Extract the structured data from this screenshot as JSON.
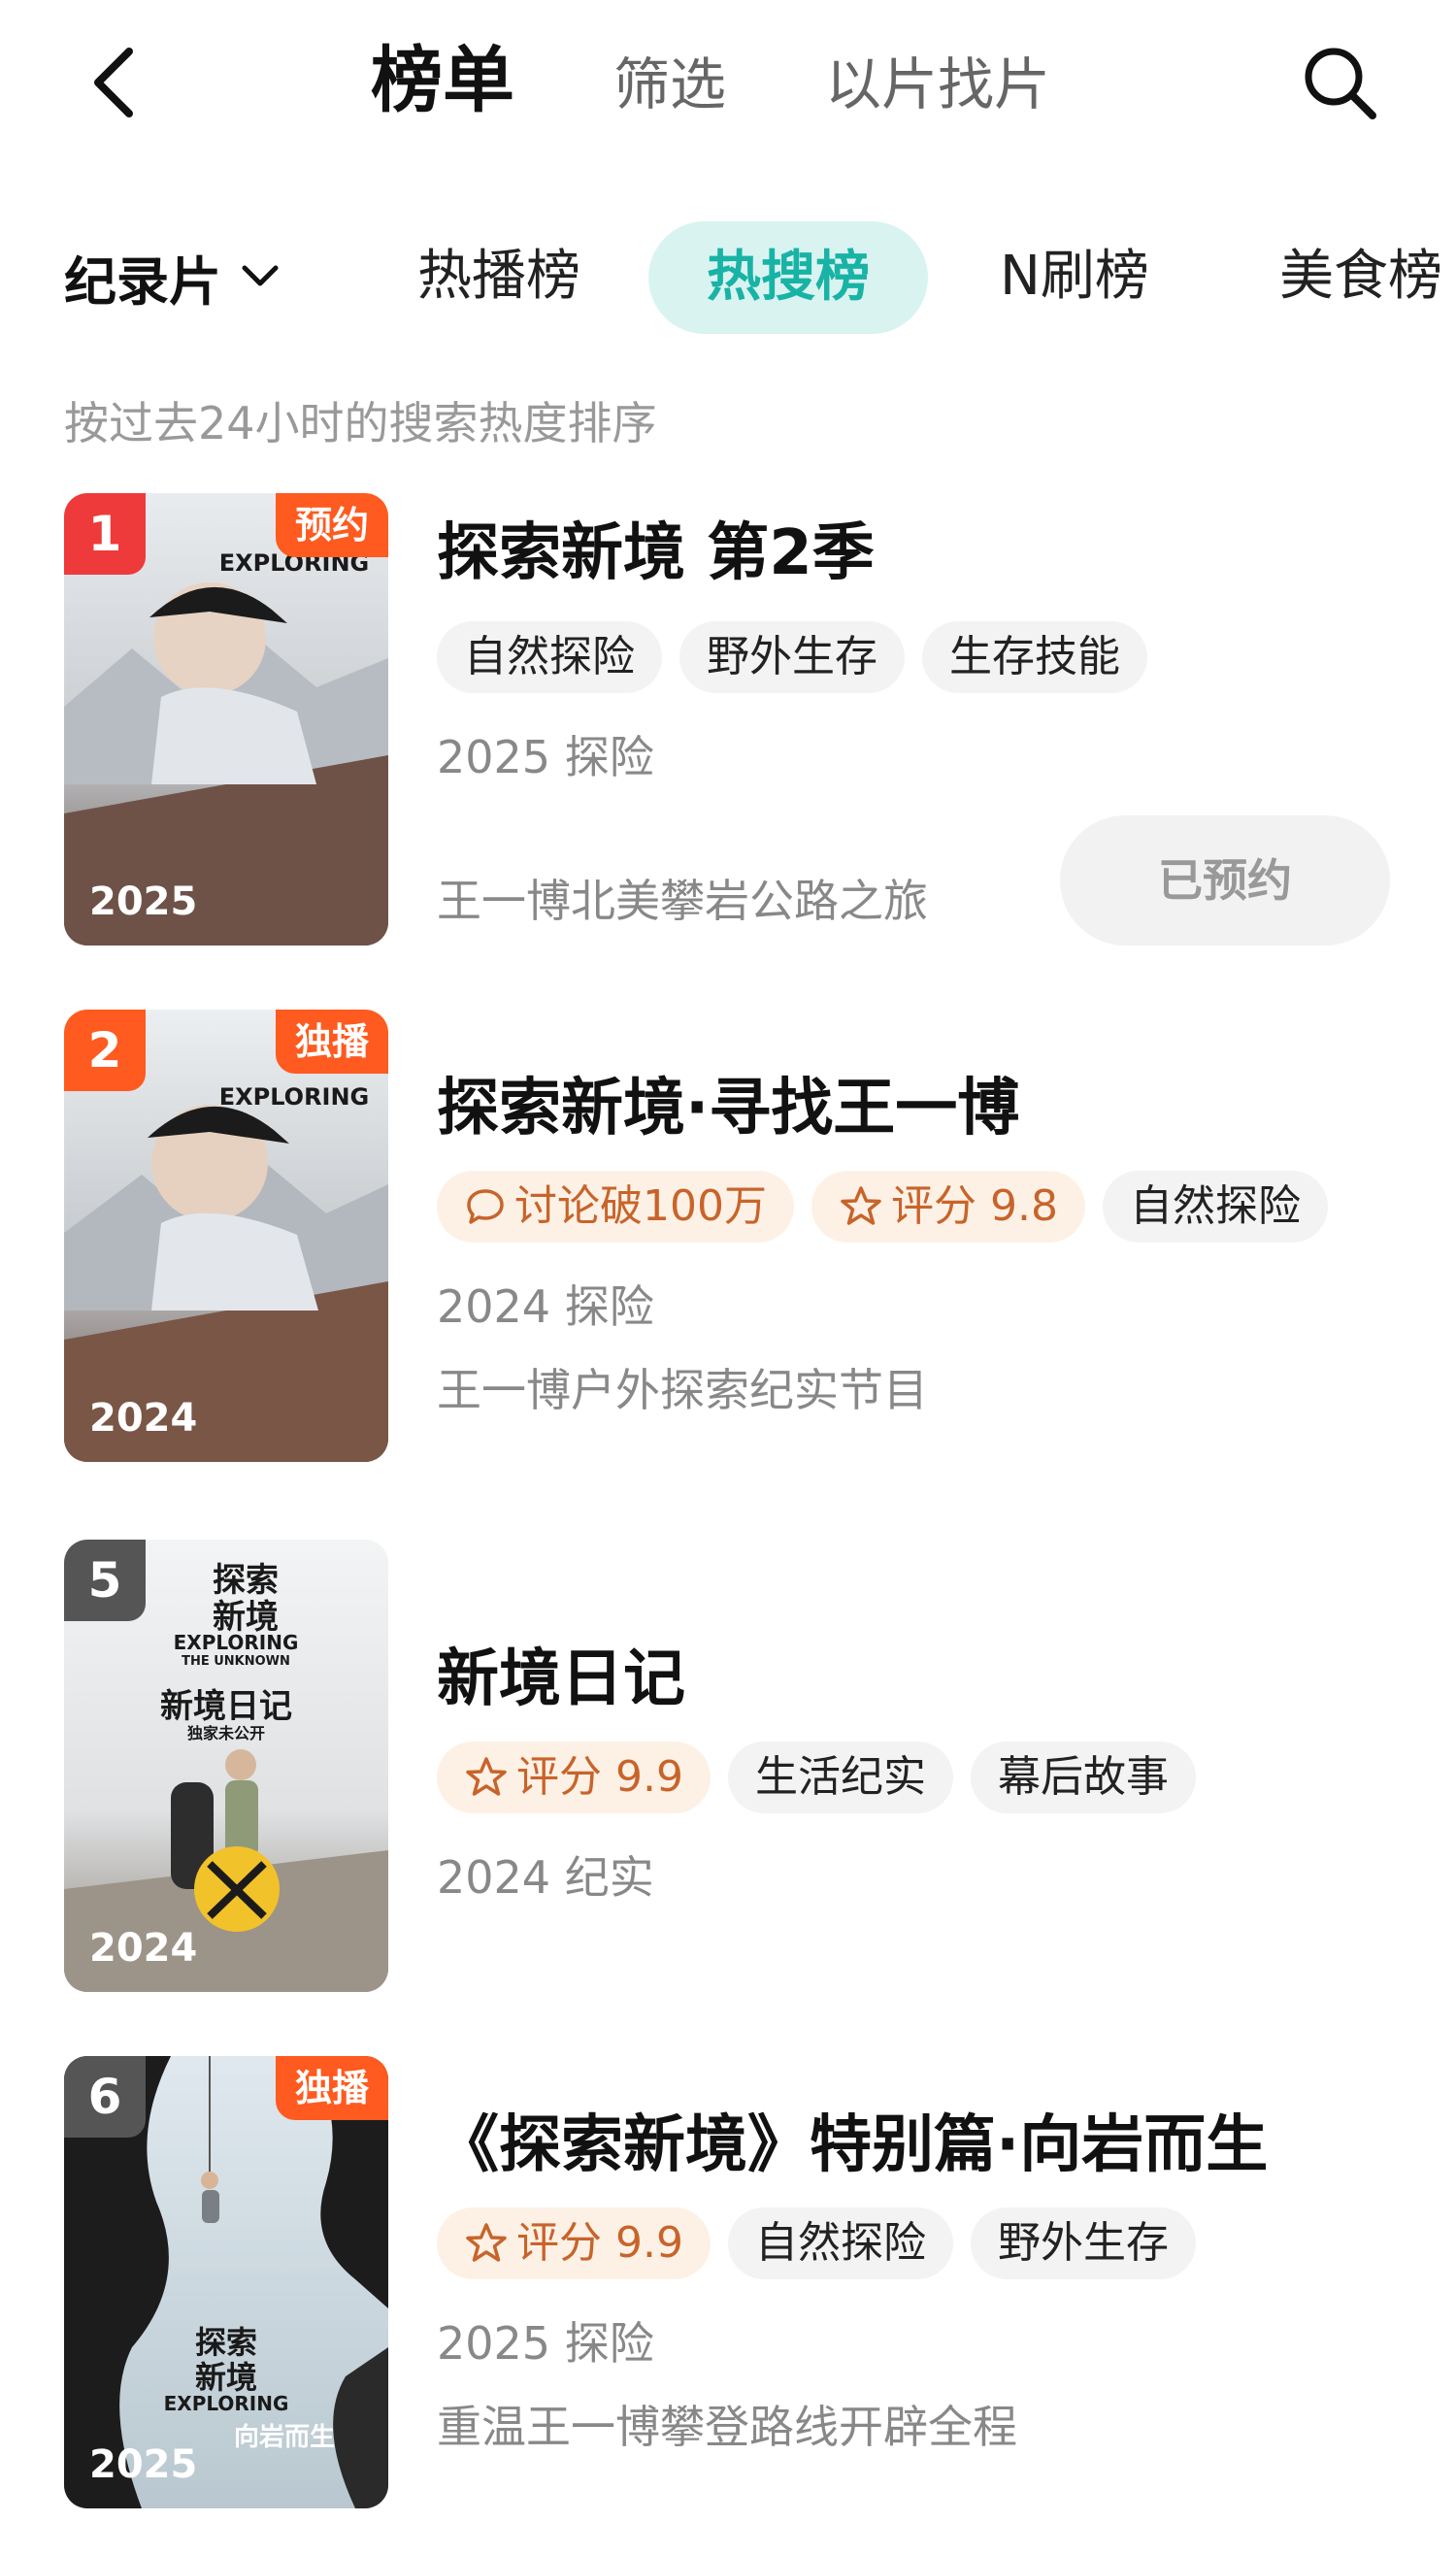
{
  "header": {
    "tabs": [
      {
        "label": "榜单",
        "active": true
      },
      {
        "label": "筛选",
        "active": false
      },
      {
        "label": "以片找片",
        "active": false
      }
    ],
    "back_icon": "chevron-left-icon",
    "search_icon": "search-icon"
  },
  "category": {
    "selected": "纪录片",
    "tabs": [
      {
        "label": "热播榜",
        "active": false
      },
      {
        "label": "热搜榜",
        "active": true
      },
      {
        "label": "N刷榜",
        "active": false
      },
      {
        "label": "美食榜",
        "active": false
      }
    ],
    "active_color": "#18b3a5"
  },
  "hint": "按过去24小时的搜索热度排序",
  "items": [
    {
      "rank": "1",
      "rank_color": "#ee3a3a",
      "badge": "预约",
      "poster_year": "2025",
      "title": "探索新境 第2季",
      "tags": [
        {
          "label": "自然探险",
          "hot": false
        },
        {
          "label": "野外生存",
          "hot": false
        },
        {
          "label": "生存技能",
          "hot": false
        }
      ],
      "meta": "2025 探险",
      "desc": "王一博北美攀岩公路之旅",
      "button": "已预约"
    },
    {
      "rank": "2",
      "rank_color": "#ff5a1f",
      "badge": "独播",
      "poster_year": "2024",
      "title": "探索新境·寻找王一博",
      "tags": [
        {
          "label": "讨论破100万",
          "hot": true,
          "icon": "comment-icon"
        },
        {
          "label": "评分 9.8",
          "hot": true,
          "icon": "star-icon"
        },
        {
          "label": "自然探险",
          "hot": false
        }
      ],
      "meta": "2024 探险",
      "desc": "王一博户外探索纪实节目"
    },
    {
      "rank": "5",
      "rank_color": "#555555",
      "poster_year": "2024",
      "poster_lines": [
        "探索",
        "新境",
        "EXPLORING",
        "THE UNKNOWN",
        "新境日记",
        "独家未公开"
      ],
      "title": "新境日记",
      "tags": [
        {
          "label": "评分 9.9",
          "hot": true,
          "icon": "star-icon"
        },
        {
          "label": "生活纪实",
          "hot": false
        },
        {
          "label": "幕后故事",
          "hot": false
        }
      ],
      "meta": "2024 纪实"
    },
    {
      "rank": "6",
      "rank_color": "#555555",
      "badge": "独播",
      "poster_year": "2025",
      "poster_lines": [
        "探索",
        "新境",
        "EXPLORING",
        "向岩而生"
      ],
      "title": "《探索新境》特别篇·向岩而生",
      "tags": [
        {
          "label": "评分 9.9",
          "hot": true,
          "icon": "star-icon"
        },
        {
          "label": "自然探险",
          "hot": false
        },
        {
          "label": "野外生存",
          "hot": false
        }
      ],
      "meta": "2025 探险",
      "desc": "重温王一博攀登路线开辟全程"
    }
  ]
}
